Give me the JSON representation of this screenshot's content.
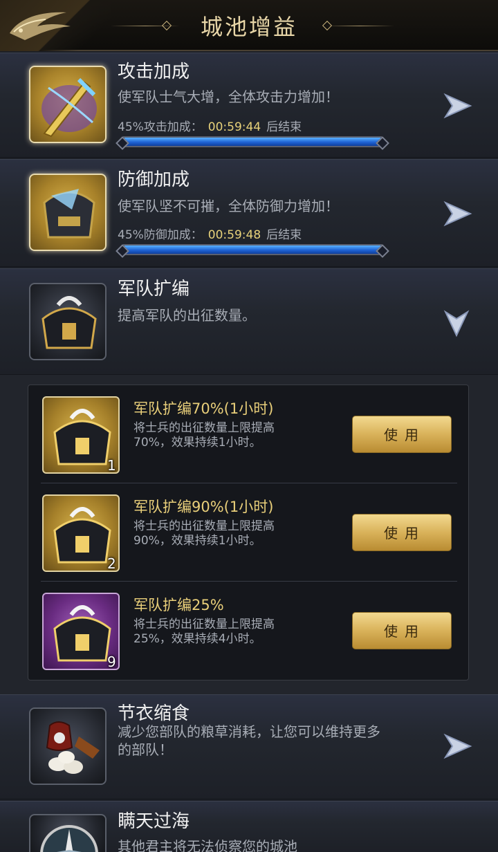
{
  "header": {
    "title": "城池增益",
    "back_icon": "dragon-back-icon"
  },
  "boosts": [
    {
      "name": "攻击加成",
      "desc": "使军队士气大增，全体攻击力增加！",
      "status_prefix": "45%攻击加成：",
      "time": "00:59:44",
      "status_suffix": "后结束",
      "progress": 1.0,
      "icon": "sword-icon"
    },
    {
      "name": "防御加成",
      "desc": "使军队坚不可摧，全体防御力增加！",
      "status_prefix": "45%防御加成：",
      "time": "00:59:48",
      "status_suffix": "后结束",
      "progress": 1.0,
      "icon": "shield-helmet-icon"
    },
    {
      "name": "军队扩编",
      "desc": "提高军队的出征数量。",
      "icon": "armor-icon",
      "expanded": true
    },
    {
      "name": "节衣缩食",
      "desc1": "减少您部队的粮草消耗，让您可以维持更多",
      "desc2": "的部队！",
      "icon": "food-icon"
    },
    {
      "name": "瞒天过海",
      "desc": "其他君主将无法侦察您的城池",
      "icon": "compass-icon"
    }
  ],
  "items": [
    {
      "name": "军队扩编70%(1小时)",
      "desc1": "将士兵的出征数量上限提高",
      "desc2": "70%，效果持续1小时。",
      "count": "1",
      "rarity": "gold",
      "button": "使用"
    },
    {
      "name": "军队扩编90%(1小时)",
      "desc1": "将士兵的出征数量上限提高",
      "desc2": "90%，效果持续1小时。",
      "count": "2",
      "rarity": "gold",
      "button": "使用"
    },
    {
      "name": "军队扩编25%",
      "desc1": "将士兵的出征数量上限提高",
      "desc2": "25%，效果持续4小时。",
      "count": "9",
      "rarity": "purple",
      "button": "使用"
    }
  ],
  "colors": {
    "accent_gold": "#e9cf7a",
    "timer": "#e8d27a",
    "bar_blue": "#1e63d4"
  }
}
